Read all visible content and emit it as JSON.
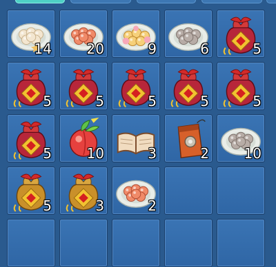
{
  "inventory": {
    "tab_count": 5,
    "slots": [
      {
        "item": "rice-ball-plate-icon",
        "count": "14"
      },
      {
        "item": "red-pastry-plate-icon",
        "count": "20"
      },
      {
        "item": "flower-cake-plate-icon",
        "count": "9"
      },
      {
        "item": "grey-dumpling-plate-icon",
        "count": "6"
      },
      {
        "item": "red-lucky-bag-icon",
        "count": "5"
      },
      {
        "item": "red-lucky-bag-icon",
        "count": "5"
      },
      {
        "item": "red-lucky-bag-icon",
        "count": "5"
      },
      {
        "item": "red-lucky-bag-icon",
        "count": "5"
      },
      {
        "item": "red-lucky-bag-icon",
        "count": "5"
      },
      {
        "item": "red-lucky-bag-icon",
        "count": "5"
      },
      {
        "item": "red-lucky-bag-icon",
        "count": "5"
      },
      {
        "item": "peach-fruit-icon",
        "count": "10"
      },
      {
        "item": "open-book-icon",
        "count": "3"
      },
      {
        "item": "orange-pouch-icon",
        "count": "2"
      },
      {
        "item": "grey-dumpling-plate-icon",
        "count": "10"
      },
      {
        "item": "gold-lucky-bag-icon",
        "count": "5"
      },
      {
        "item": "gold-lucky-bag-icon",
        "count": "3"
      },
      {
        "item": "red-pastry-plate-icon",
        "count": "2"
      },
      {
        "item": "empty-slot",
        "count": ""
      },
      {
        "item": "empty-slot",
        "count": ""
      },
      {
        "item": "empty-slot",
        "count": ""
      },
      {
        "item": "empty-slot",
        "count": ""
      },
      {
        "item": "empty-slot",
        "count": ""
      },
      {
        "item": "empty-slot",
        "count": ""
      },
      {
        "item": "empty-slot",
        "count": ""
      }
    ]
  }
}
